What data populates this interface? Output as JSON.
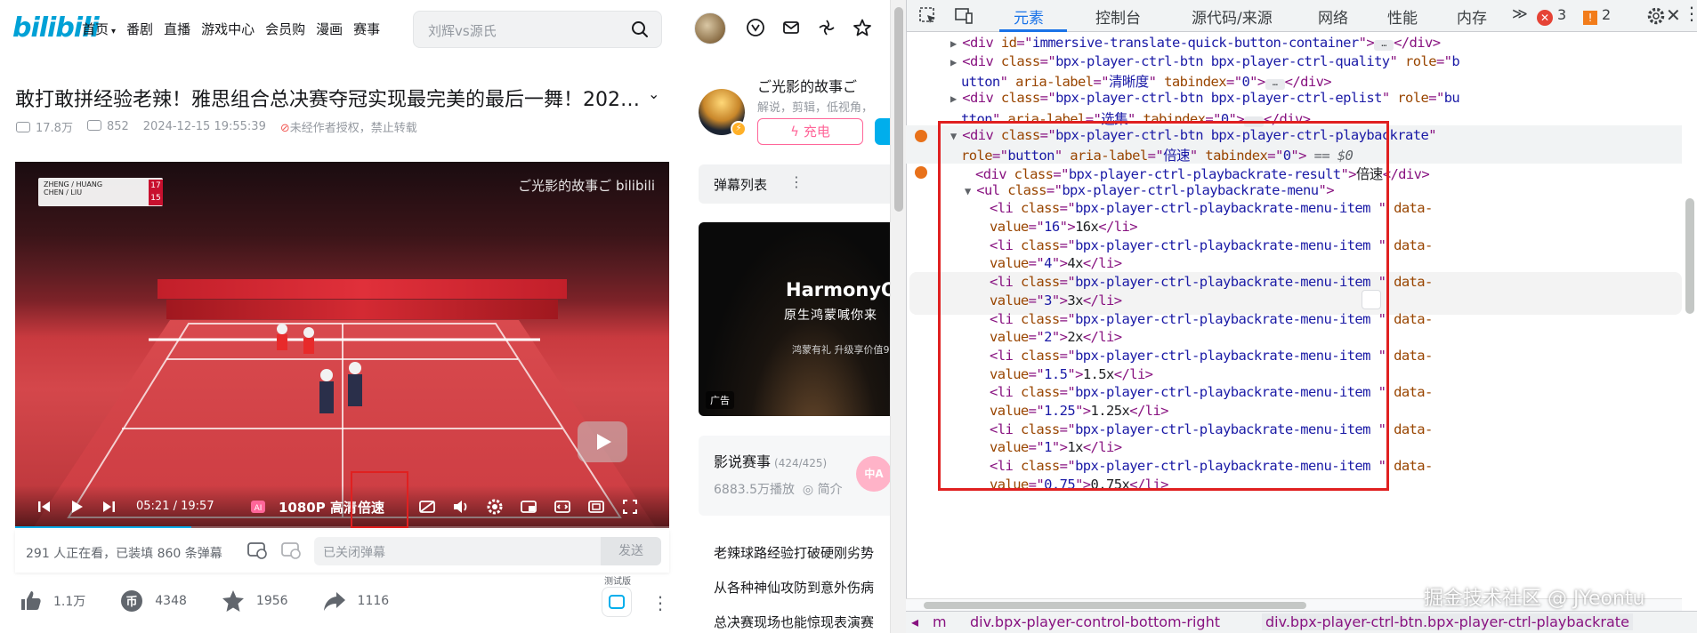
{
  "bili": {
    "logo": "bilibili",
    "nav": [
      "首页",
      "番剧",
      "直播",
      "游戏中心",
      "会员购",
      "漫画",
      "赛事"
    ],
    "search_placeholder": "刘辉vs源氏",
    "video_title": "敢打敢拼经验老辣！雅思组合总决赛夺冠实现最完美的最后一舞！202…",
    "views": "17.8万",
    "danmaku_count": "852",
    "publish_time": "2024-12-15 19:55:39",
    "no_repost": "未经作者授权，禁止转载",
    "player": {
      "watermark": "ご光影的故事ご bilibili",
      "score_team1": "ZHENG / HUANG",
      "score_team2": "CHEN / LIU",
      "score_num1": "17",
      "score_num2": "15",
      "time_current": "05:21",
      "time_total": "19:57",
      "quality": "1080P 高清",
      "speed": "倍速",
      "progress": 0.27
    },
    "danmaku_bar": {
      "online": "291 人正在看，已装填 860 条弹幕",
      "placeholder": "已关闭弹幕",
      "send": "发送"
    },
    "actions": {
      "like": "1.1万",
      "coin": "4348",
      "favorite": "1956",
      "share": "1116",
      "ai_tag": "测试版"
    },
    "up": {
      "name": "ご光影的故事ご",
      "desc": "解说，剪辑，低视角，",
      "charge": "充电"
    },
    "danmaku_list": "弹幕列表",
    "ad": {
      "title": "HarmonyOS",
      "subtitle": "原生鸿蒙喊你来",
      "line": "鸿蒙有礼 升级享价值9",
      "tag": "广告"
    },
    "collection": {
      "title": "影说赛事",
      "count": "(424/425)",
      "plays": "6883.5万播放",
      "intro": "简介"
    },
    "related": [
      "老辣球路经验打破硬刚劣势",
      "从各种神仙攻防到意外伤病",
      "总决赛现场也能惊现表演赛"
    ]
  },
  "devtools": {
    "tabs": [
      "元素",
      "控制台",
      "源代码/来源",
      "网络",
      "性能",
      "内存"
    ],
    "active_tab": "元素",
    "errors": "3",
    "warnings": "2",
    "lines": [
      {
        "indent": 1,
        "tri": "▶",
        "parts": [
          [
            "tg",
            "<div "
          ],
          [
            "at",
            "id"
          ],
          [
            "tg",
            "=\""
          ],
          [
            "av",
            "immersive-translate-quick-button-container"
          ],
          [
            "tg",
            "\">"
          ],
          [
            "ell",
            ""
          ],
          [
            "tg",
            "</div>"
          ]
        ]
      },
      {
        "indent": 1,
        "tri": "▶",
        "parts": [
          [
            "tg",
            "<div "
          ],
          [
            "at",
            "class"
          ],
          [
            "tg",
            "=\""
          ],
          [
            "av",
            "bpx-player-ctrl-btn bpx-player-ctrl-quality"
          ],
          [
            "tg",
            "\" "
          ],
          [
            "at",
            "role"
          ],
          [
            "tg",
            "=\""
          ],
          [
            "av",
            "b"
          ]
        ]
      },
      {
        "indent": 1,
        "tri": "",
        "parts": [
          [
            "av",
            "utton"
          ],
          [
            "tg",
            "\" "
          ],
          [
            "at",
            "aria-label"
          ],
          [
            "tg",
            "=\""
          ],
          [
            "av",
            "清晰度"
          ],
          [
            "tg",
            "\" "
          ],
          [
            "at",
            "tabindex"
          ],
          [
            "tg",
            "=\""
          ],
          [
            "av",
            "0"
          ],
          [
            "tg",
            "\">"
          ],
          [
            "ell",
            ""
          ],
          [
            "tg",
            "</div>"
          ]
        ]
      },
      {
        "indent": 1,
        "tri": "▶",
        "parts": [
          [
            "tg",
            "<div "
          ],
          [
            "at",
            "class"
          ],
          [
            "tg",
            "=\""
          ],
          [
            "av",
            "bpx-player-ctrl-btn bpx-player-ctrl-eplist"
          ],
          [
            "tg",
            "\" "
          ],
          [
            "at",
            "role"
          ],
          [
            "tg",
            "=\""
          ],
          [
            "av",
            "bu"
          ]
        ]
      },
      {
        "indent": 1,
        "tri": "",
        "parts": [
          [
            "av",
            "tton"
          ],
          [
            "tg",
            "\" "
          ],
          [
            "at",
            "aria-label"
          ],
          [
            "tg",
            "=\""
          ],
          [
            "av",
            "选集"
          ],
          [
            "tg",
            "\" "
          ],
          [
            "at",
            "tabindex"
          ],
          [
            "tg",
            "=\""
          ],
          [
            "av",
            "0"
          ],
          [
            "tg",
            "\">"
          ],
          [
            "ell",
            ""
          ],
          [
            "tg",
            "</div>"
          ]
        ]
      },
      {
        "indent": 1,
        "tri": "▼",
        "parts": [
          [
            "tg",
            "<div "
          ],
          [
            "at",
            "class"
          ],
          [
            "tg",
            "=\""
          ],
          [
            "av",
            "bpx-player-ctrl-btn bpx-player-ctrl-playbackrate"
          ],
          [
            "tg",
            "\""
          ]
        ]
      },
      {
        "indent": 1,
        "tri": "",
        "parts": [
          [
            "at",
            "role"
          ],
          [
            "tg",
            "=\""
          ],
          [
            "av",
            "button"
          ],
          [
            "tg",
            "\" "
          ],
          [
            "at",
            "aria-label"
          ],
          [
            "tg",
            "=\""
          ],
          [
            "av",
            "倍速"
          ],
          [
            "tg",
            "\" "
          ],
          [
            "at",
            "tabindex"
          ],
          [
            "tg",
            "=\""
          ],
          [
            "av",
            "0"
          ],
          [
            "tg",
            "\">"
          ],
          [
            "gy",
            " == $0"
          ]
        ]
      },
      {
        "indent": 2,
        "tri": "",
        "parts": [
          [
            "tg",
            "<div "
          ],
          [
            "at",
            "class"
          ],
          [
            "tg",
            "=\""
          ],
          [
            "av",
            "bpx-player-ctrl-playbackrate-result"
          ],
          [
            "tg",
            "\">"
          ],
          [
            "tx",
            "倍速"
          ],
          [
            "tg",
            "</div>"
          ]
        ]
      },
      {
        "indent": 2,
        "tri": "▼",
        "parts": [
          [
            "tg",
            "<ul "
          ],
          [
            "at",
            "class"
          ],
          [
            "tg",
            "=\""
          ],
          [
            "av",
            "bpx-player-ctrl-playbackrate-menu"
          ],
          [
            "tg",
            "\">"
          ]
        ]
      },
      {
        "indent": 3,
        "tri": "",
        "parts": [
          [
            "tg",
            "<li "
          ],
          [
            "at",
            "class"
          ],
          [
            "tg",
            "=\""
          ],
          [
            "av",
            "bpx-player-ctrl-playbackrate-menu-item "
          ],
          [
            "tg",
            "\" "
          ],
          [
            "at",
            "data-"
          ]
        ]
      },
      {
        "indent": 3,
        "tri": "",
        "parts": [
          [
            "at",
            "value"
          ],
          [
            "tg",
            "=\""
          ],
          [
            "av",
            "16"
          ],
          [
            "tg",
            "\">"
          ],
          [
            "tx",
            "16x"
          ],
          [
            "tg",
            "</li>"
          ]
        ]
      },
      {
        "indent": 3,
        "tri": "",
        "parts": [
          [
            "tg",
            "<li "
          ],
          [
            "at",
            "class"
          ],
          [
            "tg",
            "=\""
          ],
          [
            "av",
            "bpx-player-ctrl-playbackrate-menu-item "
          ],
          [
            "tg",
            "\" "
          ],
          [
            "at",
            "data-"
          ]
        ]
      },
      {
        "indent": 3,
        "tri": "",
        "parts": [
          [
            "at",
            "value"
          ],
          [
            "tg",
            "=\""
          ],
          [
            "av",
            "4"
          ],
          [
            "tg",
            "\">"
          ],
          [
            "tx",
            "4x"
          ],
          [
            "tg",
            "</li>"
          ]
        ]
      },
      {
        "indent": 3,
        "tri": "",
        "parts": [
          [
            "tg",
            "<li "
          ],
          [
            "at",
            "class"
          ],
          [
            "tg",
            "=\""
          ],
          [
            "av",
            "bpx-player-ctrl-playbackrate-menu-item "
          ],
          [
            "tg",
            "\" "
          ],
          [
            "at",
            "data-"
          ]
        ]
      },
      {
        "indent": 3,
        "tri": "",
        "parts": [
          [
            "at",
            "value"
          ],
          [
            "tg",
            "=\""
          ],
          [
            "av",
            "3"
          ],
          [
            "tg",
            "\">"
          ],
          [
            "tx",
            "3x"
          ],
          [
            "tg",
            "</li>"
          ]
        ]
      },
      {
        "indent": 3,
        "tri": "",
        "parts": [
          [
            "tg",
            "<li "
          ],
          [
            "at",
            "class"
          ],
          [
            "tg",
            "=\""
          ],
          [
            "av",
            "bpx-player-ctrl-playbackrate-menu-item "
          ],
          [
            "tg",
            "\" "
          ],
          [
            "at",
            "data-"
          ]
        ]
      },
      {
        "indent": 3,
        "tri": "",
        "parts": [
          [
            "at",
            "value"
          ],
          [
            "tg",
            "=\""
          ],
          [
            "av",
            "2"
          ],
          [
            "tg",
            "\">"
          ],
          [
            "tx",
            "2x"
          ],
          [
            "tg",
            "</li>"
          ]
        ]
      },
      {
        "indent": 3,
        "tri": "",
        "parts": [
          [
            "tg",
            "<li "
          ],
          [
            "at",
            "class"
          ],
          [
            "tg",
            "=\""
          ],
          [
            "av",
            "bpx-player-ctrl-playbackrate-menu-item "
          ],
          [
            "tg",
            "\" "
          ],
          [
            "at",
            "data-"
          ]
        ]
      },
      {
        "indent": 3,
        "tri": "",
        "parts": [
          [
            "at",
            "value"
          ],
          [
            "tg",
            "=\""
          ],
          [
            "av",
            "1.5"
          ],
          [
            "tg",
            "\">"
          ],
          [
            "tx",
            "1.5x"
          ],
          [
            "tg",
            "</li>"
          ]
        ]
      },
      {
        "indent": 3,
        "tri": "",
        "parts": [
          [
            "tg",
            "<li "
          ],
          [
            "at",
            "class"
          ],
          [
            "tg",
            "=\""
          ],
          [
            "av",
            "bpx-player-ctrl-playbackrate-menu-item "
          ],
          [
            "tg",
            "\" "
          ],
          [
            "at",
            "data-"
          ]
        ]
      },
      {
        "indent": 3,
        "tri": "",
        "parts": [
          [
            "at",
            "value"
          ],
          [
            "tg",
            "=\""
          ],
          [
            "av",
            "1.25"
          ],
          [
            "tg",
            "\">"
          ],
          [
            "tx",
            "1.25x"
          ],
          [
            "tg",
            "</li>"
          ]
        ]
      },
      {
        "indent": 3,
        "tri": "",
        "parts": [
          [
            "tg",
            "<li "
          ],
          [
            "at",
            "class"
          ],
          [
            "tg",
            "=\""
          ],
          [
            "av",
            "bpx-player-ctrl-playbackrate-menu-item "
          ],
          [
            "tg",
            "\" "
          ],
          [
            "at",
            "data-"
          ]
        ]
      },
      {
        "indent": 3,
        "tri": "",
        "parts": [
          [
            "at",
            "value"
          ],
          [
            "tg",
            "=\""
          ],
          [
            "av",
            "1"
          ],
          [
            "tg",
            "\">"
          ],
          [
            "tx",
            "1x"
          ],
          [
            "tg",
            "</li>"
          ]
        ]
      },
      {
        "indent": 3,
        "tri": "",
        "parts": [
          [
            "tg",
            "<li "
          ],
          [
            "at",
            "class"
          ],
          [
            "tg",
            "=\""
          ],
          [
            "av",
            "bpx-player-ctrl-playbackrate-menu-item "
          ],
          [
            "tg",
            "\" "
          ],
          [
            "at",
            "data-"
          ]
        ]
      },
      {
        "indent": 3,
        "tri": "",
        "parts": [
          [
            "at",
            "value"
          ],
          [
            "tg",
            "=\""
          ],
          [
            "av",
            "0.75"
          ],
          [
            "tg",
            "\">"
          ],
          [
            "tx",
            "0.75x"
          ],
          [
            "tg",
            "</li>"
          ]
        ]
      }
    ],
    "breadcrumbs": [
      "m",
      "div.bpx-player-control-bottom-right",
      "div.bpx-player-ctrl-btn.bpx-player-ctrl-playbackrate"
    ],
    "watermark": "掘金技术社区 @ JYeontu"
  }
}
